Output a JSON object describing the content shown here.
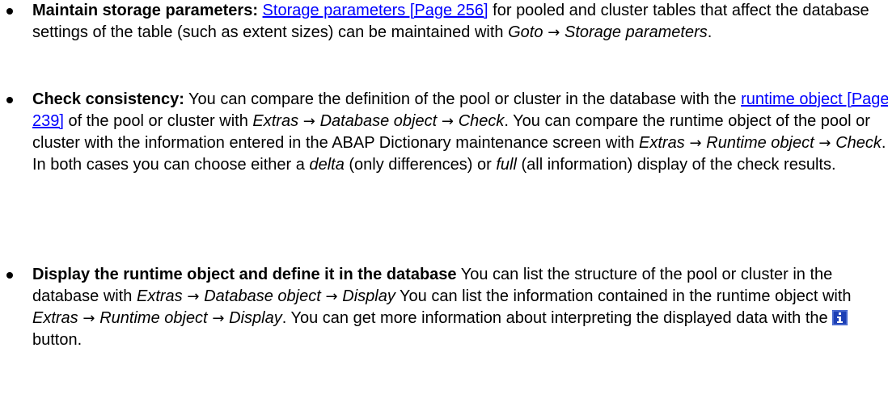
{
  "items": [
    {
      "heading": "Maintain storage parameters:",
      "link": "Storage parameters [Page 256]",
      "t1": " for pooled and cluster tables that affect the database settings of the table (such as extent sizes) can be maintained with ",
      "i1": "Goto",
      "arrow": " → ",
      "i2": "Storage parameters",
      "t2": "."
    },
    {
      "heading": "Check consistency:",
      "t1": " You can compare the definition of the pool or cluster in the database with the ",
      "link": "runtime object [Page 239]",
      "t2": " of the pool or cluster with ",
      "i1": "Extras",
      "arrow1": " → ",
      "i2": "Database object",
      "arrow2": " → ",
      "i3": "Check",
      "t3": ". You can compare the runtime object of the pool or cluster with the information entered in the ABAP Dictionary maintenance screen with ",
      "i4": "Extras",
      "arrow3": " → ",
      "i5": "Runtime object",
      "arrow4": " → ",
      "i6": "Check",
      "t4": ". In both cases you can choose either a ",
      "i7": "delta",
      "t5": " (only differences) or ",
      "i8": "full",
      "t6": " (all information) display of the check results."
    },
    {
      "heading": "Display the runtime object and define it in the database",
      "t1": " You can list the structure of the pool or cluster in the database with ",
      "i1": "Extras",
      "arrow1": " → ",
      "i2": "Database object",
      "arrow2": " → ",
      "i3": "Display",
      "t2": " You can list the information contained in the runtime object with ",
      "i4": "Extras",
      "arrow3": " → ",
      "i5": "Runtime object",
      "arrow4": " → ",
      "i6": "Display",
      "t3": ". You can get more information about interpreting the displayed data with the ",
      "icon": "info-icon",
      "t4": " button."
    }
  ],
  "colors": {
    "link": "#0000ff",
    "icon_bg": "#1c3fb5",
    "icon_fg": "#ffffff"
  }
}
